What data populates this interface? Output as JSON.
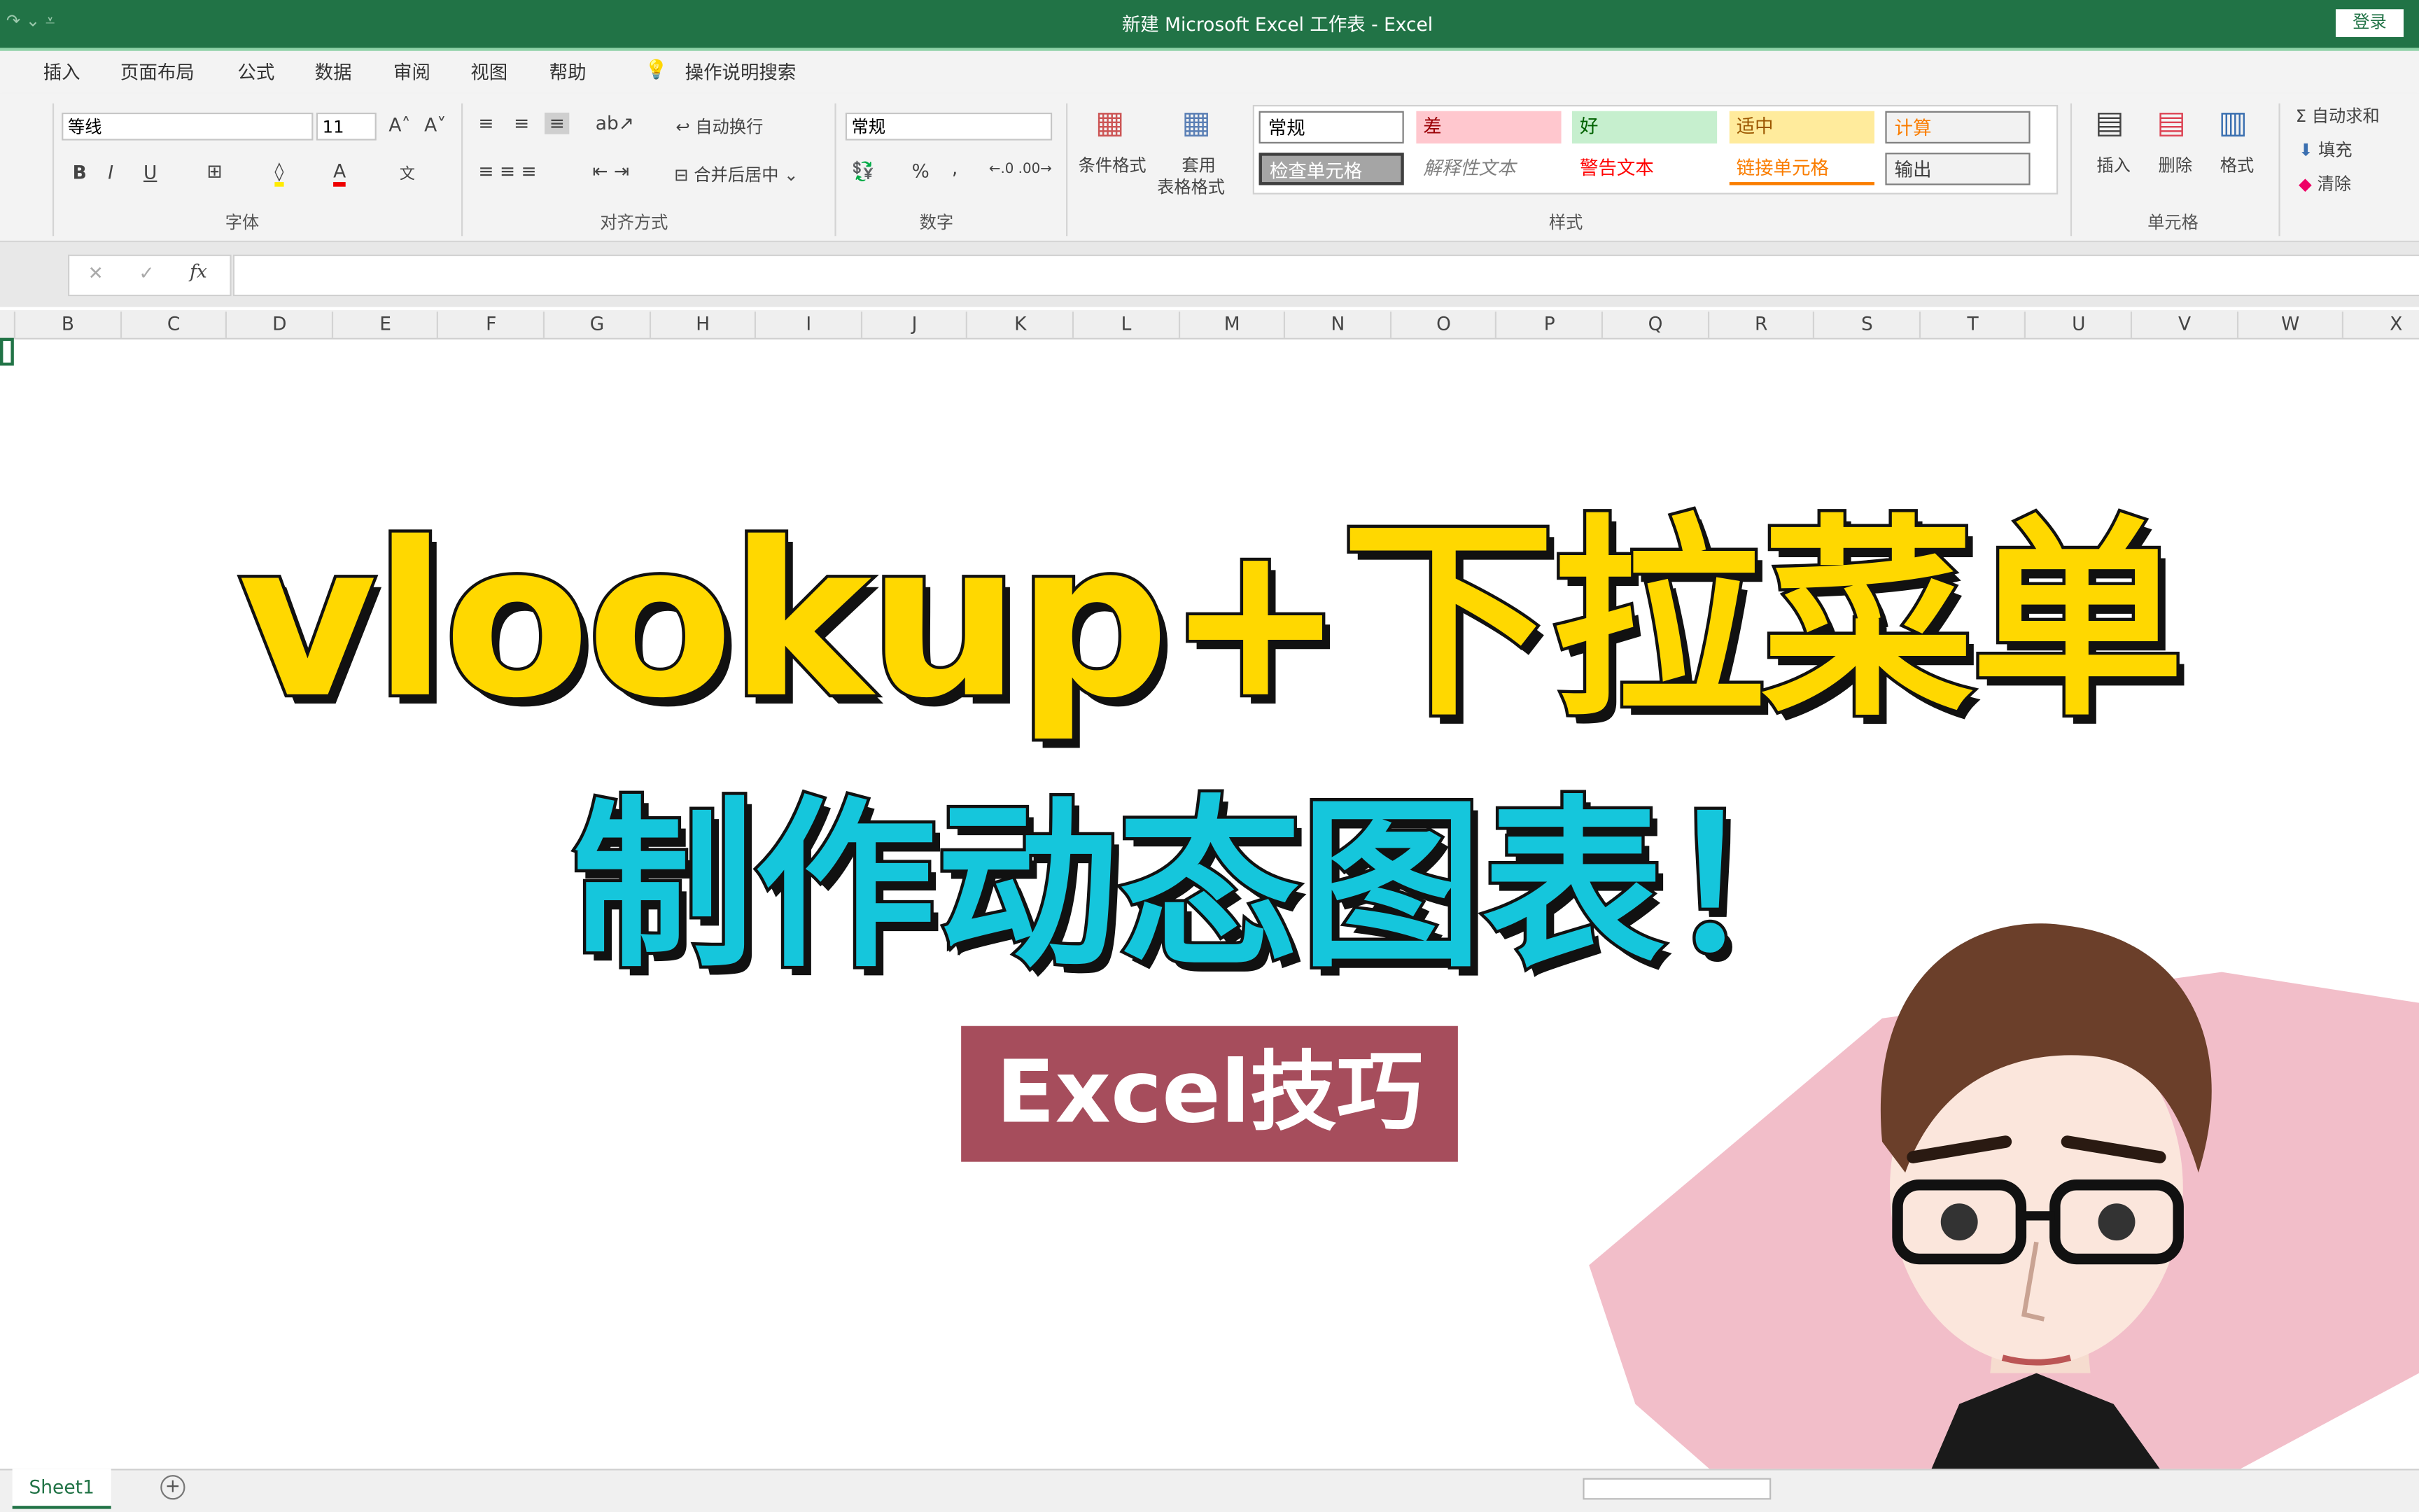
{
  "window": {
    "title": "新建 Microsoft Excel 工作表  -  Excel",
    "login": "登录"
  },
  "tabs": [
    "插入",
    "页面布局",
    "公式",
    "数据",
    "审阅",
    "视图",
    "帮助"
  ],
  "tell_me": "操作说明搜索",
  "ribbon": {
    "font": {
      "name": "等线",
      "size": "11",
      "group": "字体",
      "bold": "B",
      "italic": "I",
      "underline": "U"
    },
    "alignment": {
      "wrap": "自动换行",
      "merge": "合并后居中",
      "group": "对齐方式"
    },
    "number": {
      "format": "常规",
      "group": "数字",
      "percent": "%",
      "comma": ","
    },
    "styles": {
      "conditional": "条件格式",
      "table1": "套用",
      "table2": "表格格式",
      "group": "样式",
      "cells": [
        {
          "label": "常规",
          "bg": "#ffffff",
          "color": "#000000"
        },
        {
          "label": "差",
          "bg": "#ffc7ce",
          "color": "#9c0006"
        },
        {
          "label": "好",
          "bg": "#c6efce",
          "color": "#006100"
        },
        {
          "label": "适中",
          "bg": "#ffeb9c",
          "color": "#9c5700"
        },
        {
          "label": "计算",
          "bg": "#f2f2f2",
          "color": "#fa7d00"
        },
        {
          "label": "检查单元格",
          "bg": "#a5a5a5",
          "color": "#ffffff"
        },
        {
          "label": "解释性文本",
          "bg": "#ffffff",
          "color": "#7f7f7f"
        },
        {
          "label": "警告文本",
          "bg": "#ffffff",
          "color": "#ff0000"
        },
        {
          "label": "链接单元格",
          "bg": "#ffffff",
          "color": "#fa7d00"
        },
        {
          "label": "输出",
          "bg": "#f2f2f2",
          "color": "#3f3f3f"
        }
      ]
    },
    "cells": {
      "insert": "插入",
      "delete": "删除",
      "format": "格式",
      "group": "单元格"
    },
    "editing": {
      "autosum": "自动求和",
      "fill": "填充",
      "clear": "清除"
    }
  },
  "formula_bar": {
    "fx": "fx",
    "value": ""
  },
  "columns": [
    "B",
    "C",
    "D",
    "E",
    "F",
    "G",
    "H",
    "I",
    "J",
    "K",
    "L",
    "M",
    "N",
    "O",
    "P",
    "Q",
    "R",
    "S",
    "T",
    "U",
    "V",
    "W",
    "X"
  ],
  "overlay": {
    "headline": "vlookup+下拉菜单",
    "subtitle": "制作动态图表！",
    "badge": "Excel技巧"
  },
  "sheets": [
    "Sheet1"
  ],
  "colors": {
    "excel_green": "#217346",
    "headline": "#ffd800",
    "subtitle": "#15c6dc",
    "badge": "#a64d5c"
  }
}
